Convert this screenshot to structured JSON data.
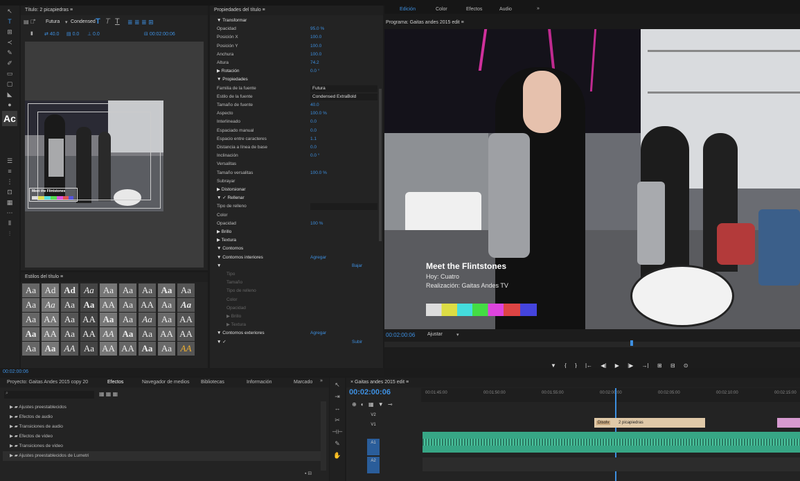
{
  "titler": {
    "title": "Título: 2 picapiedras",
    "font_name": "Futura",
    "font_style": "Condensed",
    "x_val": "40.0",
    "y_val": "0.0",
    "r_val": "0.0",
    "timecode": "00:02:00:06",
    "preview_lower_title": "Meet the Flintstones"
  },
  "styles": {
    "title": "Estilos del título",
    "samples": [
      "Aa",
      "Ad",
      "Ad",
      "Aa",
      "Aa",
      "Aa",
      "Aa",
      "Aa",
      "Aa",
      "Aa",
      "Aa",
      "Aa",
      "Aa",
      "AA",
      "Aa",
      "AA",
      "Aa",
      "Aa",
      "Aa",
      "AA",
      "Aa",
      "AA",
      "Aa",
      "Aa",
      "Aa",
      "Aa",
      "AA",
      "Aa",
      "AA",
      "Aa",
      "AA",
      "AA",
      "Aa",
      "Aa",
      "AA",
      "AA",
      "Aa",
      "Aa",
      "AA",
      "Aa",
      "AA",
      "AA",
      "Aa",
      "Aa",
      "AA"
    ]
  },
  "props": {
    "title": "Propiedades del título",
    "rows": [
      {
        "label": "▼ Transformar",
        "value": ""
      },
      {
        "label": "Opacidad",
        "value": "95.0 %"
      },
      {
        "label": "Posición X",
        "value": "100.0"
      },
      {
        "label": "Posición Y",
        "value": "100.0"
      },
      {
        "label": "Anchura",
        "value": "100.0"
      },
      {
        "label": "Altura",
        "value": "74.2"
      },
      {
        "label": "▶ Rotación",
        "value": "0.0 °"
      },
      {
        "label": "▼ Propiedades",
        "value": ""
      },
      {
        "label": "Familia de la fuente",
        "value": "Futura",
        "drop": true
      },
      {
        "label": "Estilo de la fuente",
        "value": "Condensed ExtraBold",
        "drop": true
      },
      {
        "label": "Tamaño de fuente",
        "value": "40.0"
      },
      {
        "label": "Aspecto",
        "value": "100.0 %"
      },
      {
        "label": "Interlineado",
        "value": "0.0"
      },
      {
        "label": "Espaciado manual",
        "value": "0.0"
      },
      {
        "label": "Espacio entre caracteres",
        "value": "1.1"
      },
      {
        "label": "Distancia a línea de base",
        "value": "0.0"
      },
      {
        "label": "Inclinación",
        "value": "0.0 °"
      },
      {
        "label": "Versalitas",
        "value": ""
      },
      {
        "label": "Tamaño versalitas",
        "value": "100.0 %"
      },
      {
        "label": "Subrayar",
        "value": ""
      },
      {
        "label": "▶ Distorsionar",
        "value": ""
      },
      {
        "label": "▼ ✓ Rellenar",
        "value": ""
      },
      {
        "label": "Tipo de relleno",
        "value": "",
        "drop": true
      },
      {
        "label": "Color",
        "value": ""
      },
      {
        "label": "Opacidad",
        "value": "100 %"
      },
      {
        "label": "▶  Brillo",
        "value": ""
      },
      {
        "label": "▶  Textura",
        "value": ""
      },
      {
        "label": "▼ Contornos",
        "value": ""
      },
      {
        "label": "▼ Contornos interiores",
        "value": "Agregar"
      },
      {
        "label": "▼",
        "value": "Bajar"
      },
      {
        "label": "Tipo",
        "value": ""
      },
      {
        "label": "Tamaño",
        "value": ""
      },
      {
        "label": "Tipo de relleno",
        "value": ""
      },
      {
        "label": "Color",
        "value": ""
      },
      {
        "label": "Opacidad",
        "value": ""
      },
      {
        "label": "▶  Brillo",
        "value": ""
      },
      {
        "label": "▶  Textura",
        "value": ""
      },
      {
        "label": "▼ Contornos exteriores",
        "value": "Agregar"
      },
      {
        "label": "▼ ✓",
        "value": "Subir"
      }
    ]
  },
  "program": {
    "tabs": [
      "Edición",
      "Color",
      "Efectos",
      "Audio"
    ],
    "header": "Programa: Gaitas andes 2015 edit",
    "overlay_title": "Meet the Flintstones",
    "overlay_line2": "Hoy: Cuatro",
    "overlay_line3": "Realización: Gaitas Andes TV",
    "timecode": "00:02:00:06",
    "fit": "Ajustar",
    "left_timecode": "00:02:00:06",
    "controls": [
      "▼",
      "{",
      "}",
      "|←",
      "◀|",
      "▶",
      "|▶",
      "→|",
      "⊞",
      "⊟",
      "⊙"
    ]
  },
  "project": {
    "tabs": [
      "Proyecto: Gaitas Andes 2015 copy 20",
      "Efectos",
      "Navegador de medios",
      "Bibliotecas",
      "Información",
      "Marcado"
    ],
    "items": [
      "Ajustes preestablecidos",
      "Efectos de audio",
      "Transiciones de audio",
      "Efectos de vídeo",
      "Transiciones de vídeo",
      "Ajustes preestablecidos de Lumetri"
    ]
  },
  "timeline": {
    "tab": "Gaitas andes 2015 edit",
    "timecode": "00:02:00:06",
    "ruler": [
      "00:01:45:00",
      "00:01:50:00",
      "00:01:55:00",
      "00:02:00:00",
      "00:02:05:00",
      "00:02:10:00",
      "00:02:15:00"
    ],
    "tracks": [
      "V2",
      "V1",
      "A1",
      "A2"
    ],
    "clip_title": "2 picapiedras",
    "clip_dissolve": "Disolv"
  }
}
